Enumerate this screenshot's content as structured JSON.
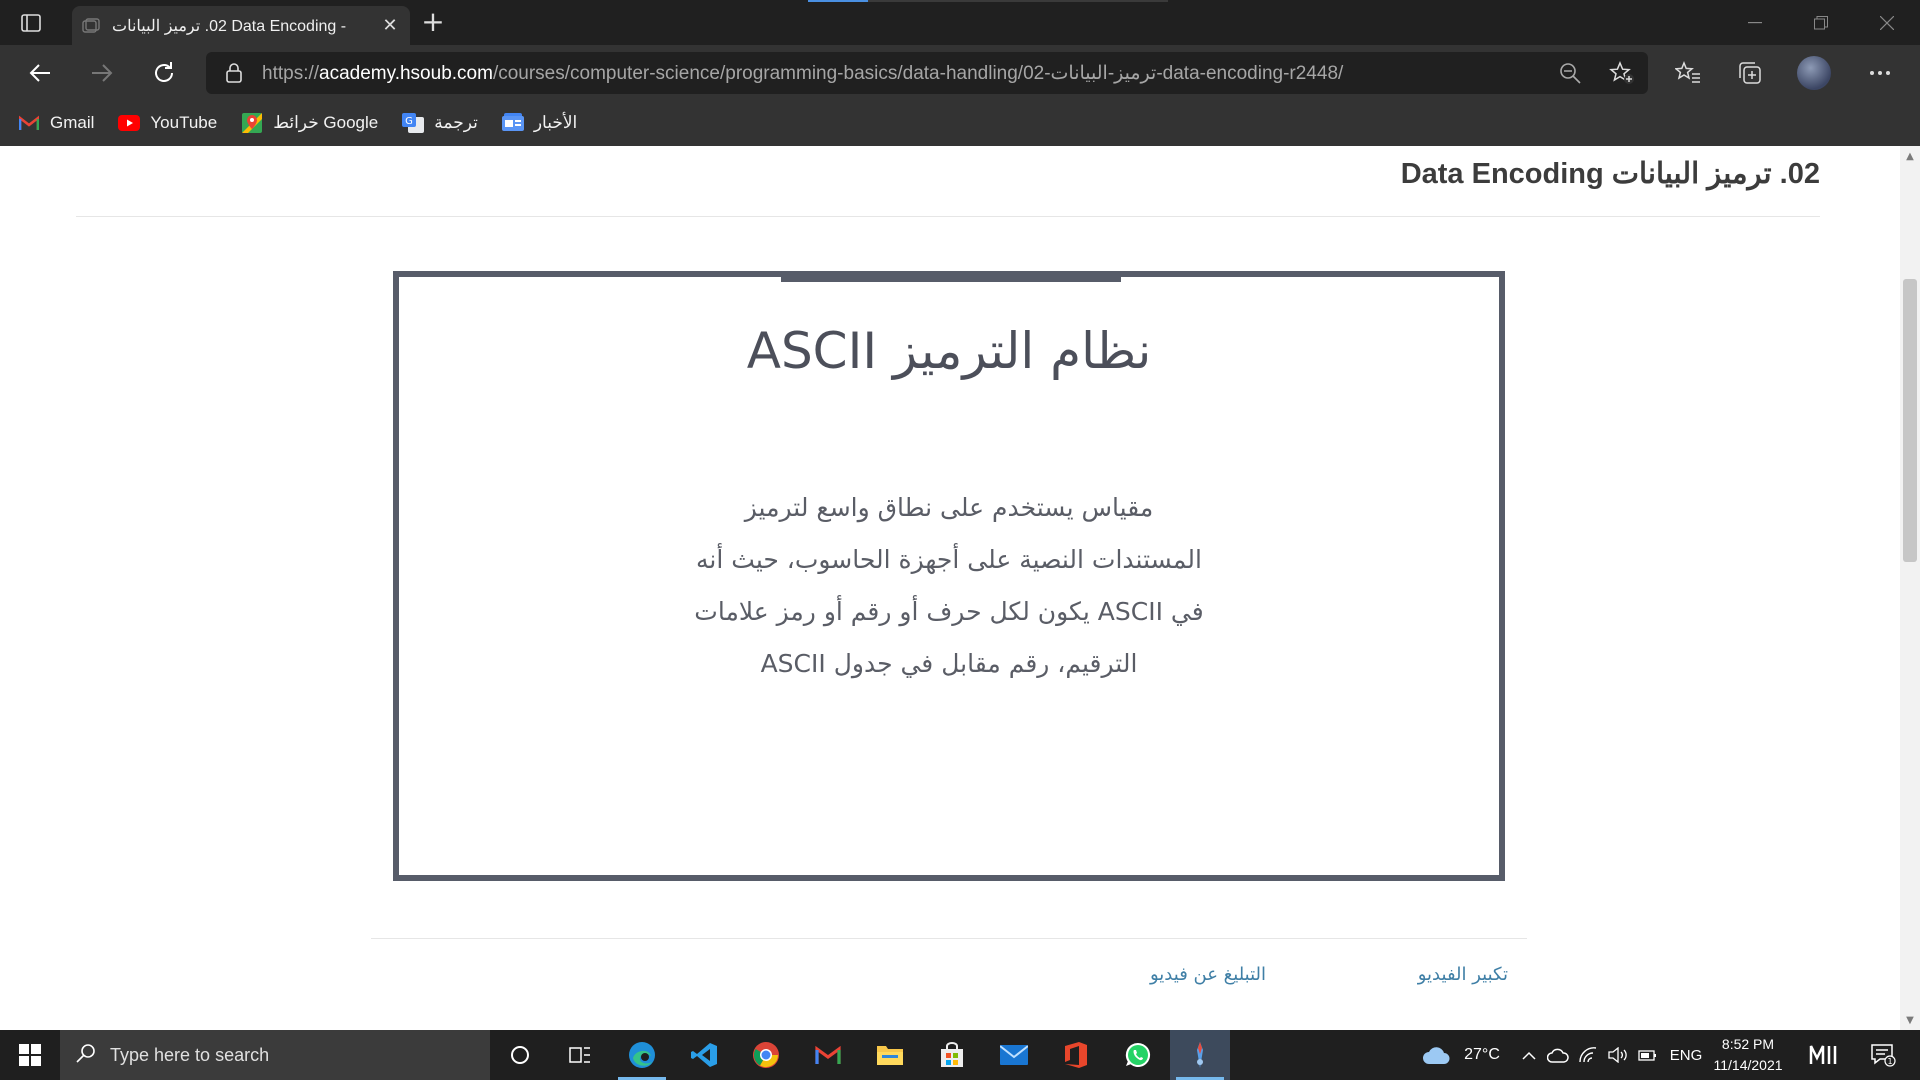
{
  "browser": {
    "tab_title": "‏02. ترميز البيانات Data Encoding -",
    "url_scheme": "https://",
    "url_host": "academy.hsoub.com",
    "url_path": "/courses/computer-science/programming-basics/data-handling/02-ترميز-البيانات-data-encoding-r2448/",
    "icons": {
      "tab_actions": "tab-actions-icon",
      "back": "back-arrow-icon",
      "forward": "forward-arrow-icon",
      "refresh": "refresh-icon",
      "lock": "lock-icon",
      "zoom": "zoom-out-icon",
      "add_favorite": "add-favorite-icon",
      "favorites": "favorites-icon",
      "collections": "collections-icon",
      "profile": "profile-avatar",
      "more": "more-options-icon"
    }
  },
  "bookmarks": [
    {
      "label": "Gmail",
      "icon": "gmail-icon"
    },
    {
      "label": "YouTube",
      "icon": "youtube-icon"
    },
    {
      "label": "خرائط Google",
      "icon": "google-maps-icon"
    },
    {
      "label": "ترجمة",
      "icon": "google-translate-icon"
    },
    {
      "label": "الأخبار",
      "icon": "google-news-icon"
    }
  ],
  "page": {
    "title": "‏02. ترميز البيانات Data Encoding",
    "video": {
      "heading": "نظام الترميز ASCII",
      "body_lines": [
        "مقياس يستخدم على نطاق واسع لترميز",
        "المستندات النصية على أجهزة  الحاسوب، حيث أنه",
        "في ASCII يكون لكل حرف أو رقم أو رمز علامات",
        "الترقيم، رقم مقابل  في جدول ASCII"
      ]
    },
    "links": {
      "enlarge": "تكبير الفيديو",
      "report": "التبليغ عن فيديو"
    }
  },
  "taskbar": {
    "search_placeholder": "Type here to search",
    "weather": "27°C",
    "language": "ENG",
    "time": "8:52 PM",
    "date": "11/14/2021",
    "notification_count": "1",
    "accent": "#76b9ed"
  }
}
